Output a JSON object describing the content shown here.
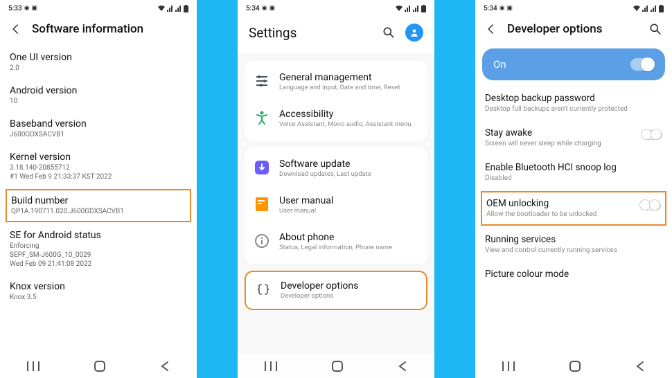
{
  "phone1": {
    "status": {
      "time": "5:33",
      "icons_left": [
        "⊙",
        "▣"
      ],
      "icons_right": [
        "wifi",
        "signal-roam",
        "signal",
        "battery"
      ]
    },
    "header": {
      "title": "Software information"
    },
    "items": [
      {
        "title": "One UI version",
        "sub": "2.0"
      },
      {
        "title": "Android version",
        "sub": "10"
      },
      {
        "title": "Baseband version",
        "sub": "J600GDXSACVB1"
      },
      {
        "title": "Kernel version",
        "sub": "3.18.140-20855712\n#1 Wed Feb 9 21:33:37 KST 2022"
      },
      {
        "title": "Build number",
        "sub": "QP1A.190711.020.J600GDXSACVB1",
        "highlight": true
      },
      {
        "title": "SE for Android status",
        "sub": "Enforcing\nSEPF_SM-J600G_10_0029\nWed Feb 09 21:41:08 2022"
      },
      {
        "title": "Knox version",
        "sub": "Knox 3.5",
        "cutoff": true
      }
    ]
  },
  "phone2": {
    "status": {
      "time": "5:34"
    },
    "header": {
      "title": "Settings"
    },
    "groups": [
      {
        "rows": [
          {
            "title": "General management",
            "sub": "Language and input, Date and time, Reset",
            "icon": "sliders",
            "icon_color": "#4a5464"
          },
          {
            "title": "Accessibility",
            "sub": "Voice Assistant, Mono audio, Assistant menu",
            "icon": "accessibility",
            "icon_color": "#27ae60"
          }
        ]
      },
      {
        "rows": [
          {
            "title": "Software update",
            "sub": "Download updates, Last update",
            "icon": "arrow-down",
            "icon_color": "#6a5cff"
          },
          {
            "title": "User manual",
            "sub": "User manual",
            "icon": "book",
            "icon_color": "#ff9500"
          },
          {
            "title": "About phone",
            "sub": "Status, Legal information, Phone name",
            "icon": "info",
            "icon_color": "#888"
          }
        ]
      },
      {
        "highlight": true,
        "rows": [
          {
            "title": "Developer options",
            "sub": "Developer options",
            "icon": "braces",
            "icon_color": "#666"
          }
        ]
      }
    ]
  },
  "phone3": {
    "status": {
      "time": "5:34"
    },
    "header": {
      "title": "Developer options"
    },
    "master": {
      "label": "On",
      "on": true
    },
    "items": [
      {
        "title": "Desktop backup password",
        "sub": "Desktop full backups aren't currently protected"
      },
      {
        "title": "Stay awake",
        "sub": "Screen will never sleep while charging",
        "toggle": false
      },
      {
        "title": "Enable Bluetooth HCI snoop log",
        "sub": "Disabled"
      },
      {
        "title": "OEM unlocking",
        "sub": "Allow the bootloader to be unlocked",
        "toggle": false,
        "highlight": true
      },
      {
        "title": "Running services",
        "sub": "View and control currently running services"
      },
      {
        "title": "Picture colour mode",
        "sub": "",
        "cutoff": true
      }
    ]
  }
}
